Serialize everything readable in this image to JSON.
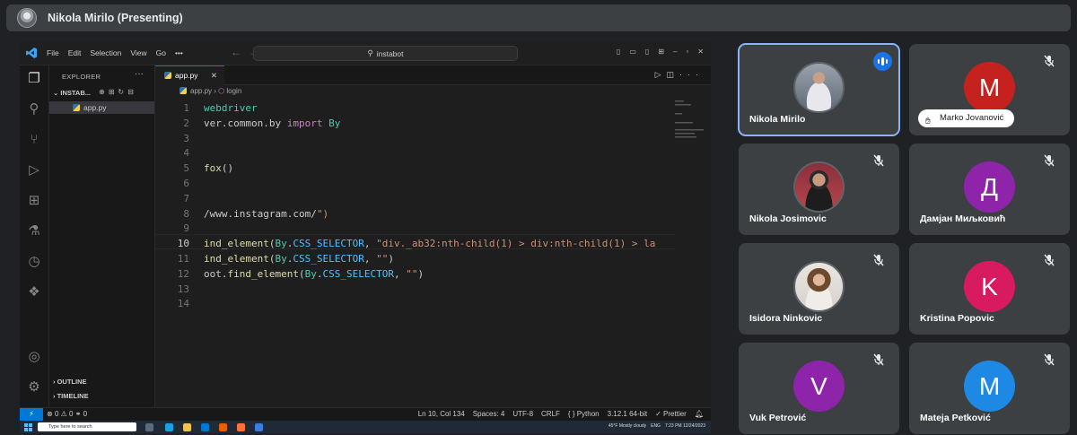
{
  "top_bar": {
    "presenter_title": "Nikola Mirilo (Presenting)"
  },
  "vscode": {
    "menu": [
      "File",
      "Edit",
      "Selection",
      "View",
      "Go",
      "•••"
    ],
    "command_center": "instabot",
    "explorer_title": "EXPLORER",
    "folder_name": "INSTAB...",
    "file_name": "app.py",
    "outline_label": "OUTLINE",
    "timeline_label": "TIMELINE",
    "tab_label": "app.py",
    "breadcrumb": {
      "file": "app.py",
      "symbol": "login"
    },
    "line_numbers": [
      "1",
      "2",
      "3",
      "4",
      "5",
      "6",
      "7",
      "8",
      "9",
      "10",
      "11",
      "12",
      "13",
      "14"
    ],
    "current_line": "10",
    "code_lines": [
      "webdriver",
      "ver.common.by import By",
      "",
      "",
      "fox()",
      "",
      "",
      "/www.instagram.com/\")",
      "",
      "ind_element(By.CSS_SELECTOR, \"div._ab32:nth-child(1) > div:nth-child(1) > la",
      "ind_element(By.CSS_SELECTOR, \"\")",
      "oot.find_element(By.CSS_SELECTOR, \"\")",
      "",
      ""
    ],
    "status": {
      "errors": "0",
      "warnings": "0",
      "ports": "0",
      "position": "Ln 10, Col 134",
      "spaces": "Spaces: 4",
      "encoding": "UTF-8",
      "eol": "CRLF",
      "language": "Python",
      "interpreter": "3.12.1 64-bit",
      "formatter": "Prettier"
    }
  },
  "windows_taskbar": {
    "search_placeholder": "Type here to search",
    "weather": "45°F  Mostly cloudy",
    "lang": "ENG",
    "time": "7:23 PM",
    "date": "12/24/2023"
  },
  "participants": [
    {
      "name": "Nikola Mirilo",
      "initial": "",
      "color": "",
      "speaking": true
    },
    {
      "name": "Marko Jovanović",
      "initial": "M",
      "color": "#c5221f",
      "hand_raised": true
    },
    {
      "name": "Nikola Josimovic",
      "initial": "",
      "color": ""
    },
    {
      "name": "Дамјан Миљковић",
      "initial": "Д",
      "color": "#8e24aa"
    },
    {
      "name": "Isidora Ninkovic",
      "initial": "",
      "color": ""
    },
    {
      "name": "Kristina Popovic",
      "initial": "K",
      "color": "#d81b60"
    },
    {
      "name": "Vuk Petrović",
      "initial": "V",
      "color": "#8e24aa"
    },
    {
      "name": "Mateja Petković",
      "initial": "M",
      "color": "#1e88e5"
    }
  ]
}
